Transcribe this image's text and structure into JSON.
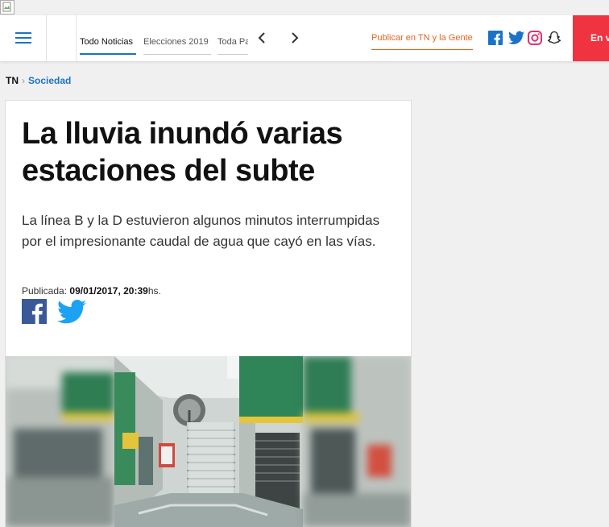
{
  "header": {
    "nav_tabs": [
      "Todo Noticias",
      "Elecciones 2019",
      "Toda Pa"
    ],
    "publish_link": "Publicar en TN y la Gente",
    "live_button": "En v",
    "social": [
      "facebook-icon",
      "twitter-icon",
      "instagram-icon",
      "snapchat-icon"
    ]
  },
  "breadcrumb": {
    "home": "TN",
    "section": "Sociedad"
  },
  "article": {
    "title": "La lluvia inundó varias estaciones del subte",
    "lead": "La línea B y la D estuvieron algunos minutos interrumpidas por el impresionante caudal de agua que cayó en las vías.",
    "published_label": "Publicada:",
    "published_date": "09/01/2017, 20:39",
    "published_suffix": "hs."
  },
  "colors": {
    "accent_blue": "#1a73c7",
    "publish_orange": "#e5651b",
    "live_red": "#ef3340",
    "facebook": "#3b5998",
    "twitter": "#1da1f2"
  }
}
